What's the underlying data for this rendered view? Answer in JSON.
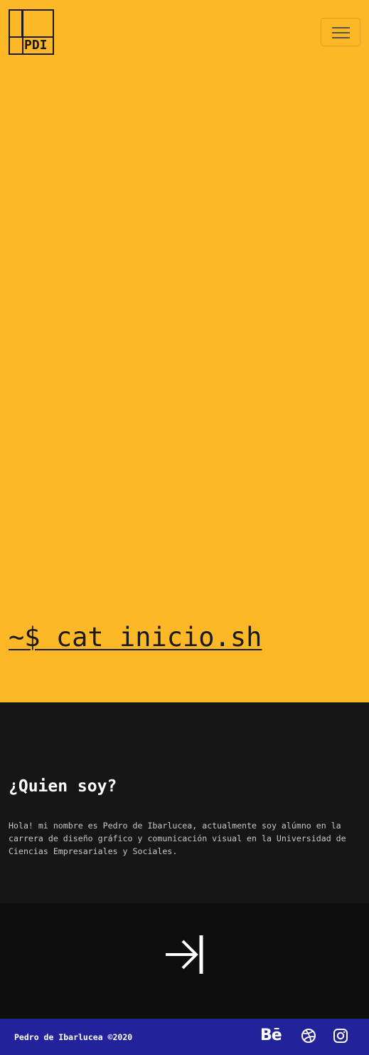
{
  "header": {
    "logo_text": "PDI",
    "menu_button_icon": "hamburger-icon"
  },
  "hero": {
    "title": "~$ cat inicio.sh",
    "background_color": "#fdb827"
  },
  "about": {
    "heading": "¿Quien soy?",
    "body": "Hola! mi nombre es Pedro de Ibarlucea, actualmente soy alúmno en la carrera de diseño gráfico y comunicación visual en la Universidad de Ciencias Empresariales y Sociales.",
    "background_color": "#161616"
  },
  "next_section": {
    "icon": "arrow-right-to-bar-icon"
  },
  "footer": {
    "copyright": "Pedro de Ibarlucea ©2020",
    "background_color": "#22229a",
    "social": [
      {
        "name": "behance-icon",
        "glyph": "Bē"
      },
      {
        "name": "dribbble-icon"
      },
      {
        "name": "instagram-icon"
      }
    ]
  }
}
